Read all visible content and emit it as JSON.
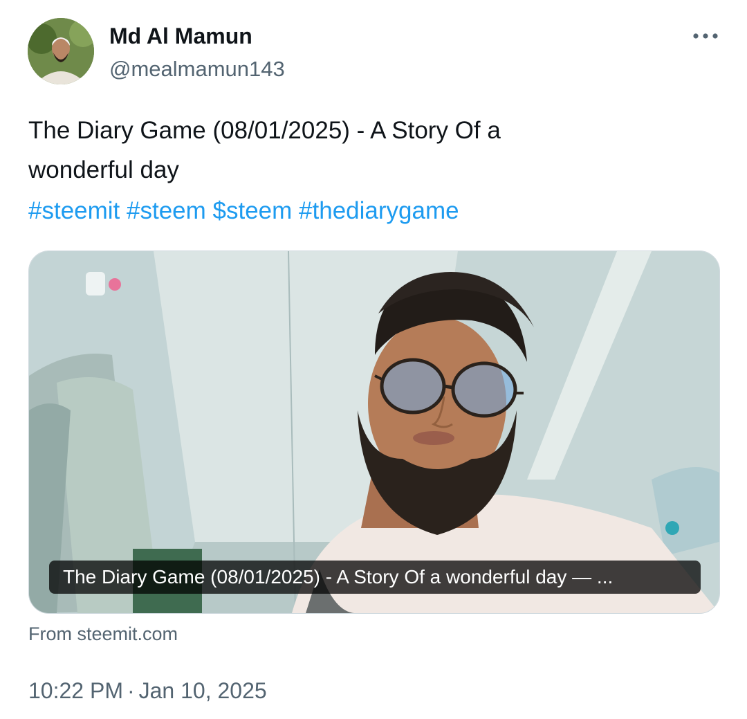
{
  "author": {
    "display_name": "Md Al Mamun",
    "handle": "@mealmamun143",
    "avatar_icon": "profile-photo"
  },
  "more_icon": "more-horizontal-icon",
  "tweet": {
    "text_lines": [
      "The Diary Game (08/01/2025) - A Story Of a",
      "wonderful day"
    ],
    "hashtags": [
      "#steemit",
      "#steem",
      "$steem",
      "#thediarygame"
    ]
  },
  "link_card": {
    "title": "The Diary Game (08/01/2025) - A Story Of a wonderful day — ...",
    "source": "From steemit.com"
  },
  "meta": {
    "time": "10:22 PM",
    "separator": "·",
    "date": "Jan 10, 2025"
  },
  "colors": {
    "accent": "#1d9bf0",
    "secondary_text": "#536471",
    "border": "#cfd9de"
  }
}
